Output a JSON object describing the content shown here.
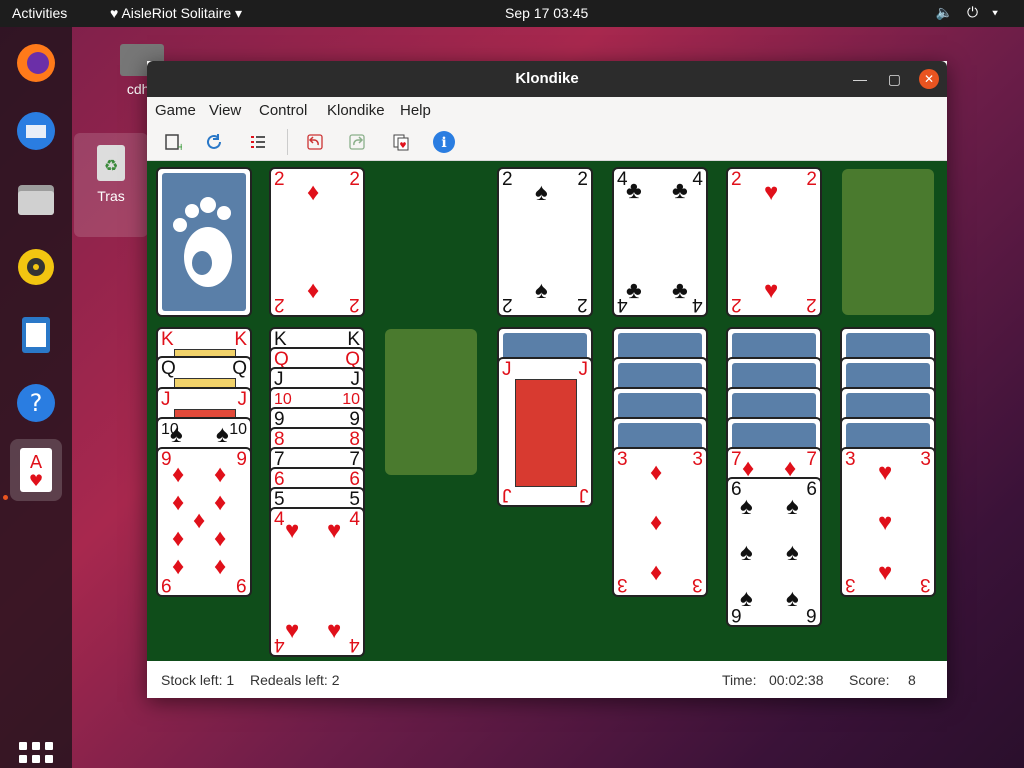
{
  "topbar": {
    "activities": "Activities",
    "app_name": "AisleRiot Solitaire",
    "clock": "Sep 17  03:45"
  },
  "desktop": {
    "home_label": "cdh8",
    "trash_label": "Tras"
  },
  "window": {
    "title": "Klondike"
  },
  "menu": {
    "game": "Game",
    "view": "View",
    "control": "Control",
    "klondike": "Klondike",
    "help": "Help"
  },
  "status": {
    "stock_left": "Stock left: 1",
    "redeals_left": "Redeals left: 2",
    "time_label": "Time:",
    "time_value": "00:02:38",
    "score_label": "Score:",
    "score_value": "8"
  },
  "colors": {
    "felt": "#0f4d1a",
    "card_back": "#5a7fa8",
    "slot": "#4a7a2e",
    "accent": "#e95420"
  },
  "cards": {
    "waste": {
      "rank": "2",
      "suit": "♦"
    },
    "f1": {
      "rank": "2",
      "suit": "♠"
    },
    "f2": {
      "rank": "4",
      "suit": "♣"
    },
    "f3": {
      "rank": "2",
      "suit": "♥"
    },
    "t1": [
      {
        "rank": "K",
        "suit": "♥"
      },
      {
        "rank": "Q",
        "suit": "♣"
      },
      {
        "rank": "J",
        "suit": "♥"
      },
      {
        "rank": "10",
        "suit": "♠"
      },
      {
        "rank": "9",
        "suit": "♦"
      }
    ],
    "t2": [
      {
        "rank": "K",
        "suit": "♠"
      },
      {
        "rank": "Q",
        "suit": "♦"
      },
      {
        "rank": "J",
        "suit": "♠"
      },
      {
        "rank": "10",
        "suit": "♦"
      },
      {
        "rank": "9",
        "suit": "♠"
      },
      {
        "rank": "8",
        "suit": "♦"
      },
      {
        "rank": "7",
        "suit": "♠"
      },
      {
        "rank": "6",
        "suit": "♦"
      },
      {
        "rank": "5",
        "suit": "♠"
      },
      {
        "rank": "4",
        "suit": "♥"
      }
    ],
    "t4": {
      "rank": "J",
      "suit": "♦"
    },
    "t5": {
      "rank": "3",
      "suit": "♦"
    },
    "t6": [
      {
        "rank": "7",
        "suit": "♦"
      },
      {
        "rank": "6",
        "suit": "♠"
      }
    ],
    "t7": {
      "rank": "3",
      "suit": "♥"
    }
  }
}
